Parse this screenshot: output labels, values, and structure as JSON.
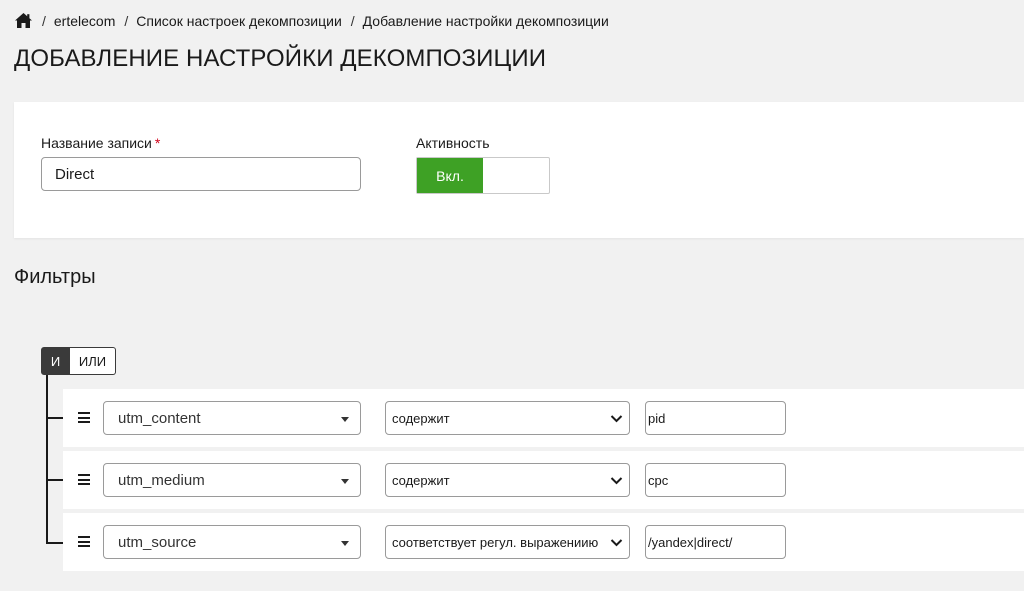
{
  "breadcrumb": {
    "items": [
      "ertelecom",
      "Список настроек декомпозиции",
      "Добавление настройки декомпозиции"
    ],
    "separator": "/"
  },
  "page": {
    "title": "ДОБАВЛЕНИЕ НАСТРОЙКИ ДЕКОМПОЗИЦИИ"
  },
  "form": {
    "name_label": "Название записи",
    "required_mark": "*",
    "name_value": "Direct",
    "activity_label": "Активность",
    "toggle_on_label": "Вкл."
  },
  "filters": {
    "title": "Фильтры",
    "logic": {
      "and_label": "И",
      "or_label": "ИЛИ",
      "selected": "И"
    },
    "rules": [
      {
        "field": "utm_content",
        "operator": "содержит",
        "value": "pid"
      },
      {
        "field": "utm_medium",
        "operator": "содержит",
        "value": "cpc"
      },
      {
        "field": "utm_source",
        "operator": "соответствует регул. выражениию",
        "value": "/yandex|direct/"
      }
    ]
  },
  "colors": {
    "background": "#f1f1f1",
    "toggle_on": "#3ea125",
    "logic_active": "#3a3a3a",
    "required": "#d0021b"
  },
  "icons": {
    "home": "home-icon",
    "drag": "drag-handle-icon",
    "caret": "caret-down-icon",
    "chevron": "chevron-down-icon"
  }
}
